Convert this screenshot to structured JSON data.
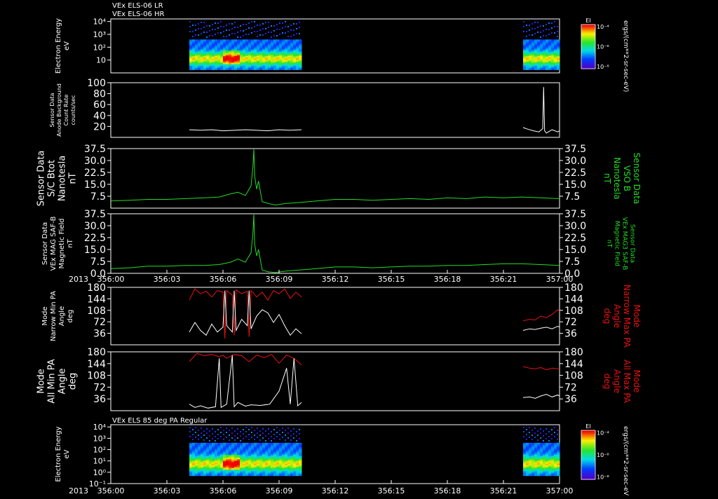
{
  "header": {
    "line1": "VEx ELS-06 LR",
    "line2": "VEx ELS-06 HR"
  },
  "year": "2013",
  "x_tick_labels": [
    "356:00",
    "356:03",
    "356:06",
    "356:09",
    "356:12",
    "356:15",
    "356:18",
    "356:21",
    "357:00"
  ],
  "colors": {
    "white": "#ffffff",
    "green": "#22dd22",
    "red": "#ee1111",
    "frame": "#ffffff"
  },
  "chart_data": [
    {
      "type": "heatmap",
      "id": "p1",
      "ylabel": [
        "Electron Energy",
        "eV"
      ],
      "yticks": [
        "10⁴",
        "10³",
        "10²",
        "10"
      ],
      "ylim_log": [
        0,
        4.2
      ],
      "segments": [
        [
          4.2,
          10.2
        ],
        [
          22.05,
          24.0
        ]
      ],
      "colorbar": {
        "title": "EI",
        "ticks": [
          "10⁻⁴",
          "10⁻⁶",
          "10⁻⁸"
        ]
      },
      "right_label": "ergs/(cm**2-sr-sec-eV)"
    },
    {
      "type": "line",
      "id": "p2",
      "ylabel": [
        "Sensor Data",
        "Anode Background",
        "Count Rate",
        "counts/sec"
      ],
      "yticks": [
        "100",
        "80",
        "60",
        "40",
        "20"
      ],
      "ylim": [
        0,
        100
      ],
      "series": [
        {
          "color": "white",
          "x": [
            4.2,
            4.8,
            5.4,
            6.0,
            6.6,
            7.2,
            7.8,
            8.4,
            9.0,
            9.6,
            10.2
          ],
          "y": [
            14,
            13,
            14,
            12,
            13,
            14,
            13,
            12,
            14,
            13,
            14
          ]
        },
        {
          "color": "white",
          "x": [
            22.05,
            22.3,
            22.6,
            22.9,
            23.1,
            23.15,
            23.2,
            23.3,
            23.6,
            23.9,
            24.0
          ],
          "y": [
            18,
            15,
            12,
            10,
            16,
            92,
            12,
            8,
            14,
            10,
            12
          ]
        }
      ]
    },
    {
      "type": "line",
      "id": "p3",
      "ylabel": [
        "Sensor Data",
        "S/C Btot",
        "Nanotesla",
        "nT"
      ],
      "right_label": [
        "Sensor Data",
        "VSO B",
        "Nanotesla",
        "nT"
      ],
      "yticks": [
        "37.5",
        "30.0",
        "22.5",
        "15.0",
        "7.5"
      ],
      "ylim": [
        0,
        37.5
      ],
      "series": [
        {
          "color": "green",
          "x": [
            0,
            1,
            2,
            3,
            4,
            5,
            5.8,
            6.4,
            6.8,
            7.2,
            7.5,
            7.6,
            7.65,
            7.7,
            7.8,
            7.9,
            8.1,
            8.4,
            8.8,
            9.4,
            10,
            11,
            12,
            13,
            14,
            15,
            16,
            17,
            18,
            19,
            20,
            21,
            22,
            23,
            24
          ],
          "y": [
            4.5,
            5,
            5.5,
            5.5,
            6,
            6.5,
            7,
            9,
            10,
            8,
            14,
            26,
            37,
            20,
            12,
            17,
            4,
            3,
            2,
            3,
            3.5,
            4.5,
            5.5,
            5.5,
            5,
            5.5,
            6,
            5.5,
            6.5,
            6,
            7,
            6.5,
            7,
            6.5,
            6
          ]
        }
      ]
    },
    {
      "type": "line",
      "id": "p4",
      "ylabel": [
        "Sensor Data",
        "VEx MAG SAF-B",
        "Magnetic Field",
        "nT"
      ],
      "right_label": [
        "Sensor Data",
        "VEx MAG3 SAF-B",
        "Magnetic Field",
        "nT"
      ],
      "yticks": [
        "37.5",
        "30.0",
        "22.5",
        "15.0",
        "7.5",
        "0.0"
      ],
      "ylim": [
        0,
        37.5
      ],
      "series": [
        {
          "color": "green",
          "x": [
            0,
            1,
            2,
            3,
            4,
            5,
            5.8,
            6.4,
            6.8,
            7.2,
            7.5,
            7.6,
            7.65,
            7.7,
            7.8,
            7.9,
            8.1,
            8.4,
            8.8,
            9.4,
            10,
            11,
            12,
            13,
            14,
            15,
            16,
            17,
            18,
            19,
            20,
            21,
            22,
            23,
            24
          ],
          "y": [
            3,
            3.5,
            4.5,
            4.5,
            5,
            5,
            5.5,
            7,
            9,
            7,
            13,
            25,
            37,
            18,
            11,
            15,
            2,
            1,
            0.5,
            1.5,
            2,
            3,
            4,
            4,
            3.5,
            4,
            4.5,
            4.5,
            5,
            5,
            5.5,
            6,
            6,
            5.5,
            5
          ]
        }
      ]
    },
    {
      "type": "line",
      "id": "p5",
      "ylabel": [
        "Mode",
        "Narrow Min PA",
        "Angle",
        "deg"
      ],
      "right_label": [
        "Mode",
        "Narrow Max PA",
        "Angle",
        "deg"
      ],
      "yticks": [
        "180",
        "144",
        "108",
        "72",
        "36"
      ],
      "ylim": [
        0,
        180
      ],
      "series": [
        {
          "color": "red",
          "x": [
            4.2,
            4.5,
            4.8,
            5.1,
            5.4,
            5.7,
            6.0,
            6.1,
            6.2,
            6.5,
            6.6,
            6.7,
            7.0,
            7.3,
            7.4,
            7.5,
            7.8,
            8.1,
            8.4,
            8.7,
            9.0,
            9.3,
            9.6,
            9.9,
            10.2
          ],
          "y": [
            140,
            175,
            160,
            168,
            150,
            170,
            165,
            20,
            170,
            155,
            30,
            172,
            160,
            168,
            25,
            170,
            150,
            165,
            140,
            170,
            160,
            175,
            145,
            165,
            150
          ]
        },
        {
          "color": "white",
          "x": [
            4.2,
            4.5,
            4.8,
            5.1,
            5.4,
            5.7,
            6.0,
            6.1,
            6.2,
            6.5,
            6.6,
            6.7,
            7.0,
            7.3,
            7.4,
            7.5,
            7.8,
            8.1,
            8.4,
            8.7,
            9.0,
            9.3,
            9.6,
            9.9,
            10.2
          ],
          "y": [
            40,
            70,
            45,
            30,
            65,
            40,
            55,
            170,
            60,
            40,
            170,
            45,
            80,
            60,
            170,
            50,
            90,
            110,
            100,
            70,
            95,
            60,
            30,
            50,
            35
          ]
        },
        {
          "color": "red",
          "x": [
            22.05,
            22.4,
            22.7,
            23.0,
            23.3,
            23.6,
            23.9,
            24.0
          ],
          "y": [
            75,
            80,
            78,
            90,
            85,
            95,
            110,
            105
          ]
        },
        {
          "color": "white",
          "x": [
            22.05,
            22.4,
            22.7,
            23.0,
            23.3,
            23.6,
            23.9,
            24.0
          ],
          "y": [
            45,
            50,
            48,
            52,
            55,
            50,
            58,
            56
          ]
        }
      ]
    },
    {
      "type": "line",
      "id": "p6",
      "ylabel": [
        "Mode",
        "All Min PA",
        "Angle",
        "deg"
      ],
      "right_label": [
        "Mode",
        "All Max PA",
        "Angle",
        "deg"
      ],
      "yticks": [
        "180",
        "144",
        "108",
        "72",
        "36"
      ],
      "ylim": [
        0,
        180
      ],
      "series": [
        {
          "color": "red",
          "x": [
            4.2,
            4.6,
            5.0,
            5.4,
            5.8,
            6.0,
            6.2,
            6.6,
            7.0,
            7.4,
            7.8,
            8.2,
            8.6,
            9.0,
            9.4,
            9.8,
            10.2
          ],
          "y": [
            150,
            175,
            168,
            172,
            165,
            170,
            160,
            172,
            168,
            150,
            170,
            162,
            172,
            145,
            170,
            160,
            140
          ]
        },
        {
          "color": "white",
          "x": [
            4.2,
            4.5,
            4.8,
            5.2,
            5.6,
            5.8,
            5.9,
            6.2,
            6.5,
            6.6,
            6.8,
            7.2,
            7.5,
            8.0,
            8.5,
            9.0,
            9.4,
            9.6,
            9.8,
            10.0,
            10.2
          ],
          "y": [
            20,
            10,
            15,
            8,
            12,
            160,
            10,
            20,
            170,
            12,
            25,
            14,
            18,
            16,
            20,
            60,
            130,
            20,
            160,
            15,
            25
          ]
        },
        {
          "color": "red",
          "x": [
            22.05,
            22.4,
            22.7,
            23.0,
            23.3,
            23.6,
            23.9,
            24.0
          ],
          "y": [
            135,
            130,
            128,
            132,
            125,
            130,
            128,
            130
          ]
        },
        {
          "color": "white",
          "x": [
            22.05,
            22.4,
            22.7,
            23.0,
            23.3,
            23.6,
            23.9,
            24.0
          ],
          "y": [
            40,
            42,
            38,
            45,
            50,
            42,
            48,
            45
          ]
        }
      ]
    },
    {
      "type": "heatmap",
      "id": "p7",
      "title": "VEx ELS 85 deg PA Regular",
      "ylabel": [
        "Electron Energy",
        "eV"
      ],
      "yticks": [
        "10⁴",
        "10³",
        "10²",
        "10¹",
        "10⁰",
        "10⁻¹"
      ],
      "ylim_log": [
        -1,
        4.2
      ],
      "segments": [
        [
          4.2,
          10.2
        ],
        [
          22.05,
          24.0
        ]
      ],
      "colorbar": {
        "title": "EI",
        "ticks": [
          "10⁻⁴",
          "10⁻⁶",
          "10⁻⁸"
        ]
      },
      "right_label": "ergs/(cm**2-sr-sec-eV)"
    }
  ]
}
